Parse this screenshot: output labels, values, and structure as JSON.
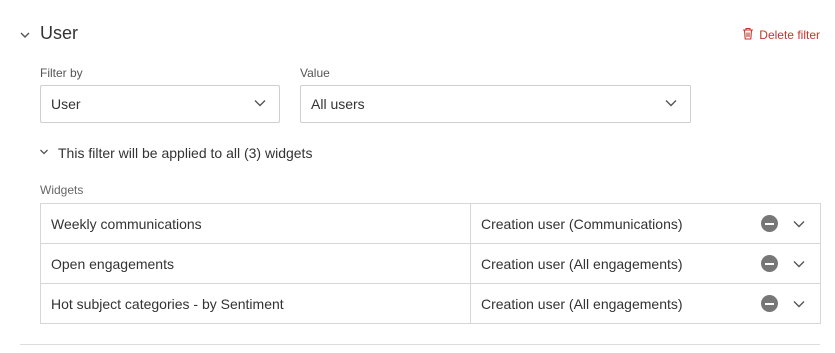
{
  "filter": {
    "title": "User",
    "delete_label": "Delete filter",
    "accent_color": "#c0392b"
  },
  "filter_by": {
    "label": "Filter by",
    "value": "User"
  },
  "value_field": {
    "label": "Value",
    "value": "All users"
  },
  "applied_text": "This filter will be applied to all (3) widgets",
  "widgets": {
    "label": "Widgets",
    "rows": [
      {
        "name": "Weekly communications",
        "field": "Creation user (Communications)"
      },
      {
        "name": "Open engagements",
        "field": "Creation user (All engagements)"
      },
      {
        "name": "Hot subject categories - by Sentiment",
        "field": "Creation user (All engagements)"
      }
    ]
  },
  "icons": [
    "chevron-down-icon",
    "trash-icon",
    "remove-circle-icon"
  ]
}
